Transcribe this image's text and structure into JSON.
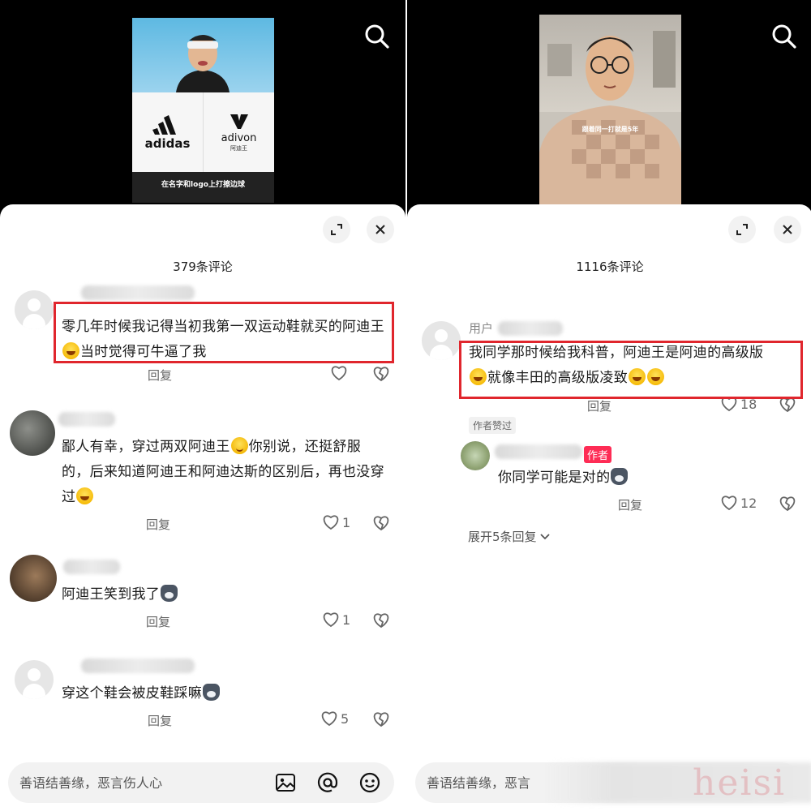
{
  "left": {
    "video": {
      "caption": "在名字和logo上打擦边球",
      "brand1": "adidas",
      "brand2": "adivon",
      "brand2_sub": "阿迪王"
    },
    "comment_count": "379条评论",
    "comments": [
      {
        "text_a": "零几年时候我记得当初我第一双运动鞋就买的阿迪王",
        "emoji": "laugh-cry-emoji",
        "text_b": "当时觉得可牛逼了我",
        "reply": "回复",
        "likes": ""
      },
      {
        "text_a": "鄙人有幸，穿过两双阿迪王",
        "emoji": "smile-emoji",
        "text_b": "你别说，还挺舒服的，后来知道阿迪王和阿迪达斯的区别后，再也没穿过",
        "emoji2": "laugh-cry-emoji",
        "reply": "回复",
        "likes": "1"
      },
      {
        "text_a": "阿迪王笑到我了",
        "emoji": "husky-emoji",
        "reply": "回复",
        "likes": "1"
      },
      {
        "text_a": "穿这个鞋会被皮鞋踩嘛",
        "emoji": "husky-emoji",
        "reply": "回复",
        "likes": "5"
      }
    ],
    "input_placeholder": "善语结善缘，恶言伤人心"
  },
  "right": {
    "video": {
      "caption": "跟着同一打就是5年"
    },
    "comment_count": "1116条评论",
    "comments": [
      {
        "username": "用户",
        "text_a": "我同学那时候给我科普，阿迪王是阿迪的高级版",
        "text_b": "就像丰田的高级版凌致",
        "reply": "回复",
        "likes": "18"
      }
    ],
    "author_liked": "作者赞过",
    "author_reply": {
      "badge": "作者",
      "text": "你同学可能是对的",
      "reply": "回复",
      "likes": "12"
    },
    "expand": "展开5条回复",
    "input_placeholder": "善语结善缘，恶言"
  },
  "watermark": "heisi",
  "colors": {
    "highlight": "#e0262d",
    "author_badge": "#fe2c55",
    "sheet_bg": "#ffffff",
    "video_bg": "#000000"
  }
}
